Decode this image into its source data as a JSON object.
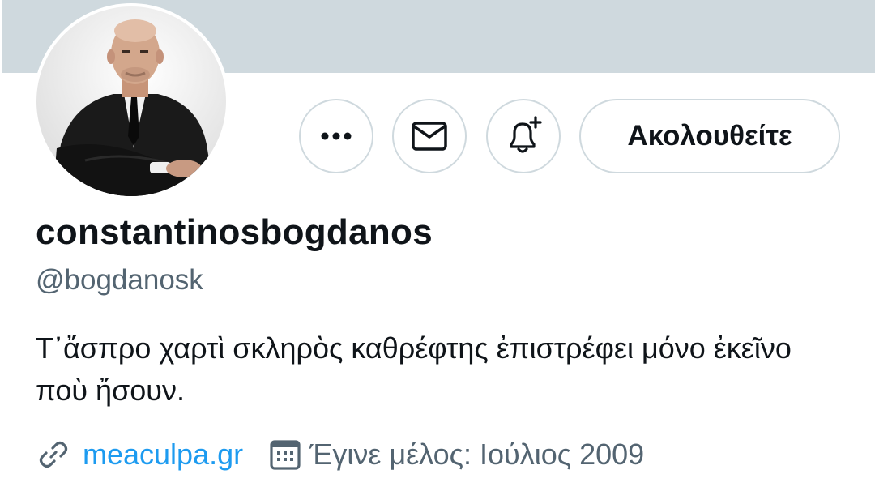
{
  "profile": {
    "display_name": "constantinosbogdanos",
    "handle": "@bogdanosk",
    "bio": "Τ᾽ἄσπρο χαρτὶ σκληρὸς καθρέφτης ἐπιστρέφει μόνο ἐκεῖνο ποὺ ἤσουν.",
    "website": "meaculpa.gr",
    "joined": "Έγινε μέλος: Ιούλιος 2009"
  },
  "actions": {
    "more_icon": "more-horizontal-icon",
    "message_icon": "envelope-icon",
    "notify_icon": "bell-plus-icon",
    "follow_label": "Ακολουθείτε"
  },
  "icons": {
    "website": "link-icon",
    "joined": "calendar-icon"
  },
  "colors": {
    "banner": "#cfd9de",
    "text_primary": "#0f1419",
    "text_secondary": "#536471",
    "link": "#1d9bf0",
    "border": "#cfd9de"
  }
}
